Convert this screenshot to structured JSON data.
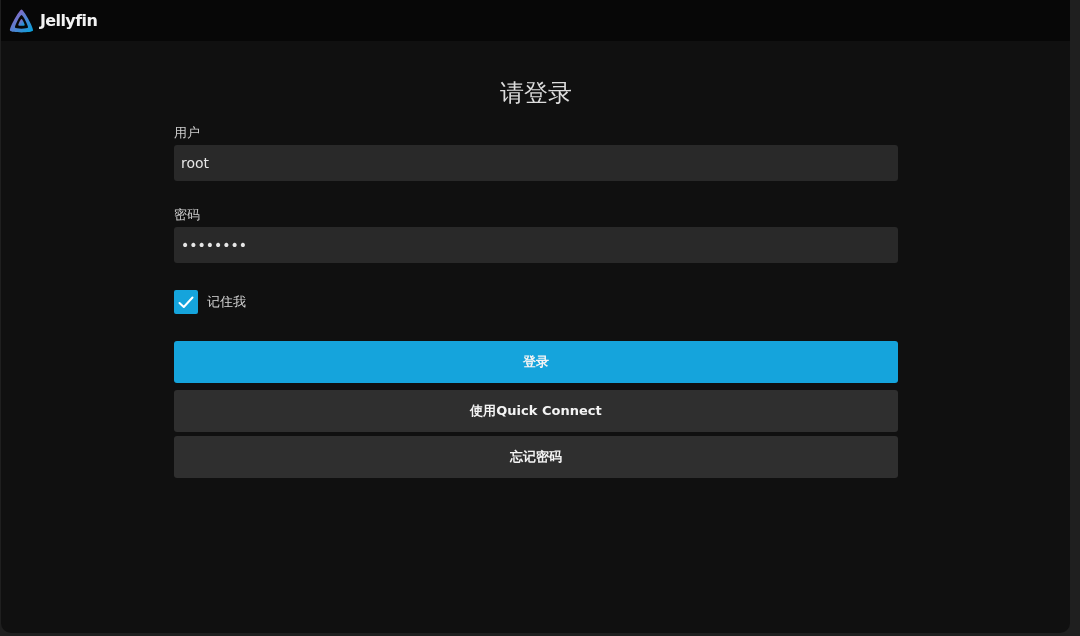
{
  "header": {
    "logo_text": "Jellyfin"
  },
  "form": {
    "title": "请登录",
    "fields": [
      {
        "label": "用户",
        "value": "root"
      },
      {
        "label": "密码",
        "value": "••••••••"
      }
    ],
    "remember": {
      "label": "记住我",
      "checked": true
    },
    "buttons": [
      {
        "label": "登录",
        "kind": "primary"
      },
      {
        "label": "使用Quick Connect",
        "kind": "secondary"
      },
      {
        "label": "忘记密码",
        "kind": "secondary"
      }
    ]
  }
}
